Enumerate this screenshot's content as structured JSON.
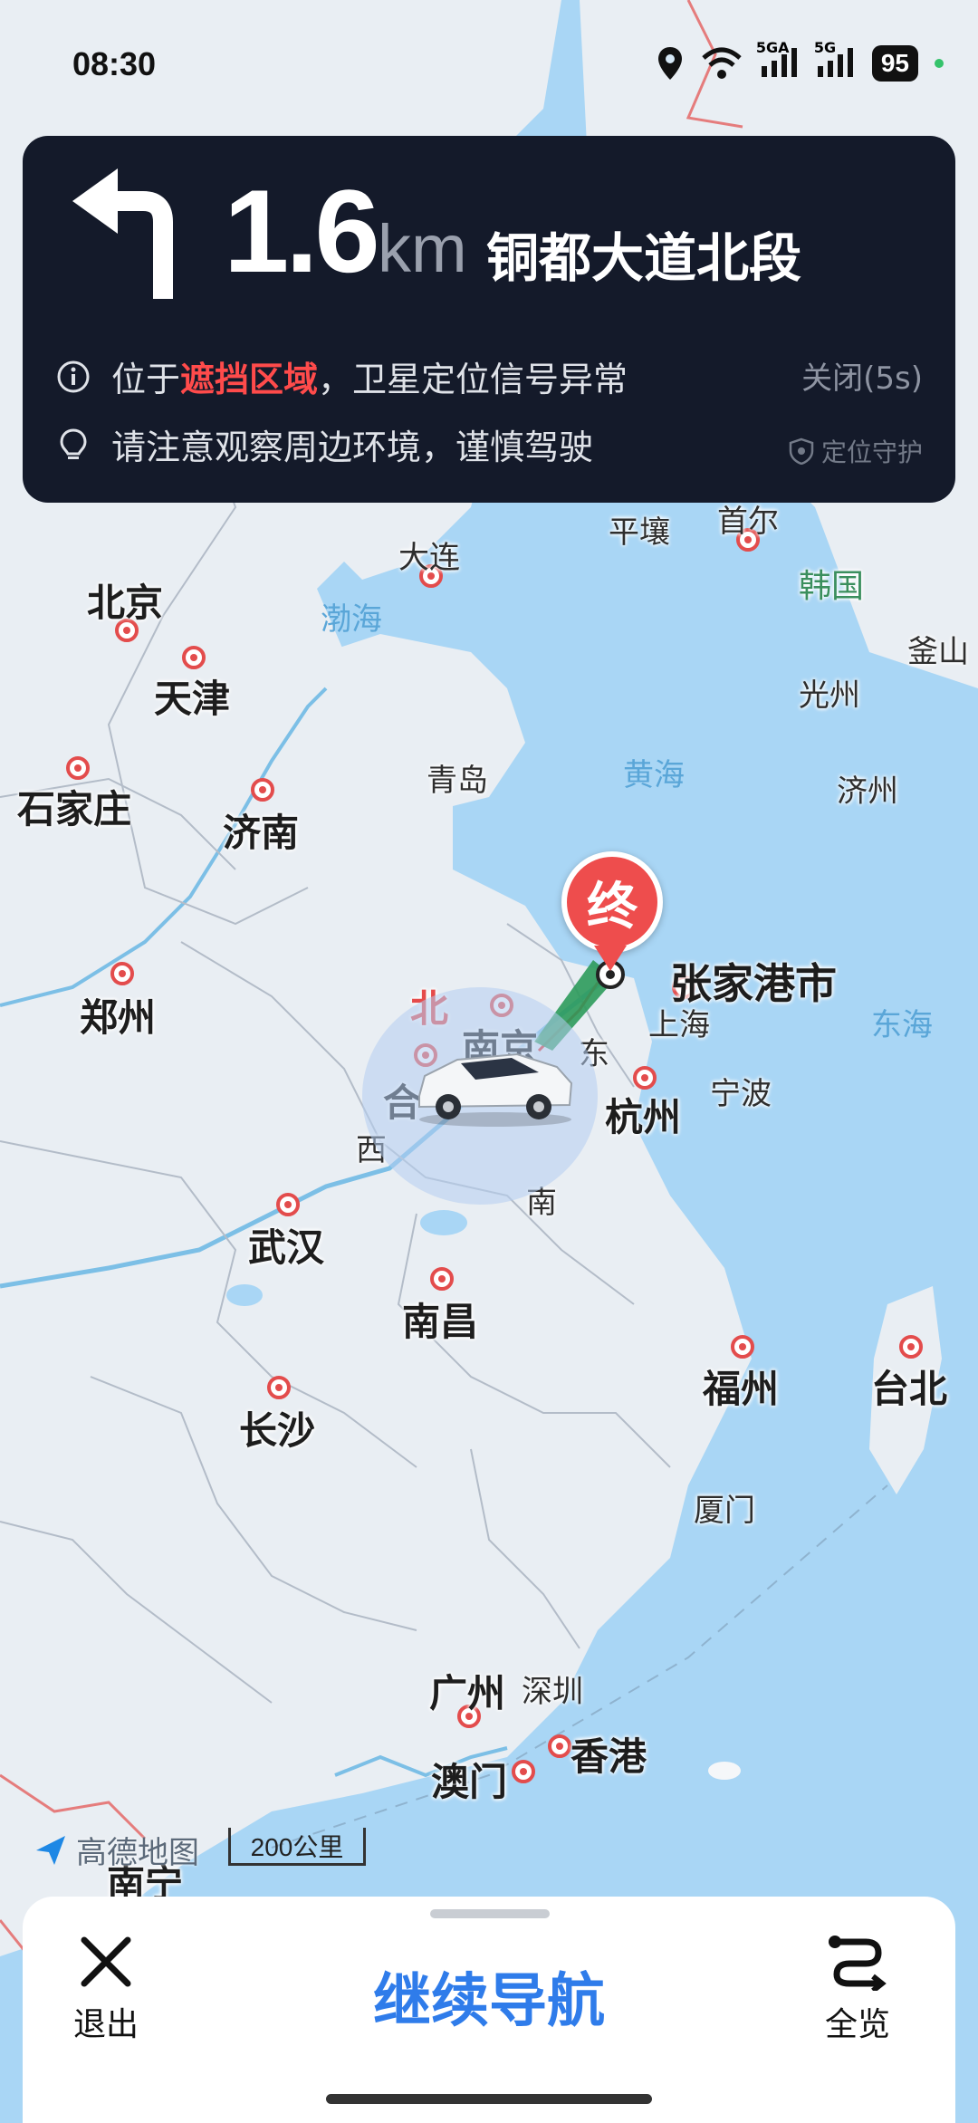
{
  "status": {
    "time": "08:30",
    "battery": "95",
    "net1": "5GA",
    "net2": "5G"
  },
  "nav": {
    "distance": "1.6",
    "unit": "km",
    "road": "铜都大道北段",
    "msg1_prefix": "位于",
    "msg1_highlight": "遮挡区域",
    "msg1_suffix": "，卫星定位信号异常",
    "msg2": "请注意观察周边环境，谨慎驾驶",
    "close": "关闭(5s)",
    "guard": "定位守护"
  },
  "map": {
    "end_marker": "终",
    "destination": "张家港市",
    "labels": {
      "beijing": "北京",
      "tianjin": "天津",
      "shijiazhuang": "石家庄",
      "jinan": "济南",
      "qingdao": "青岛",
      "dalian": "大连",
      "bohai": "渤海",
      "pyongyang": "平壤",
      "seoul": "首尔",
      "korea": "韩国",
      "busan": "釜山",
      "gwangju": "光州",
      "jeju": "济州",
      "yellowsea": "黄海",
      "zhengzhou": "郑州",
      "nanjing": "南京",
      "shanghai": "上海",
      "hangzhou": "杭州",
      "ningbo": "宁波",
      "eastsea": "东海",
      "wuhan": "武汉",
      "nanchang": "南昌",
      "changsha": "长沙",
      "fuzhou": "福州",
      "taipei": "台北",
      "xiamen": "厦门",
      "guangzhou": "广州",
      "shenzhen": "深圳",
      "hongkong": "香港",
      "macau": "澳门",
      "nanning": "南宁",
      "bei": "北",
      "dong": "东",
      "nan": "南",
      "xi": "西",
      "he": "合"
    },
    "logo": "高德地图",
    "scale": "200公里"
  },
  "bottom": {
    "exit": "退出",
    "continue": "继续导航",
    "overview": "全览"
  }
}
